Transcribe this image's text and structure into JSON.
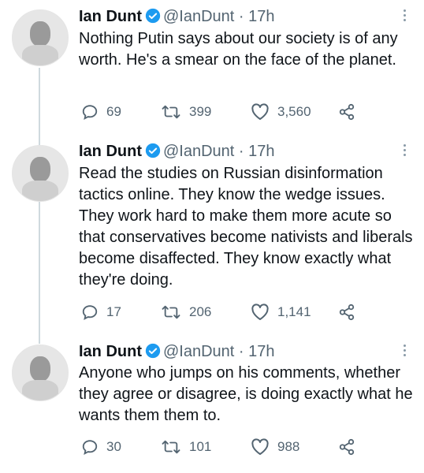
{
  "tweets": [
    {
      "name": "Ian Dunt",
      "handle": "@IanDunt",
      "time": "· 17h",
      "text": "Nothing Putin says about our society is of any worth. He's a smear on the face of the planet.",
      "replies": "69",
      "retweets": "399",
      "likes": "3,560"
    },
    {
      "name": "Ian Dunt",
      "handle": "@IanDunt",
      "time": "· 17h",
      "text": "Read the studies on Russian disinformation tactics online. They know the wedge issues. They work hard to make them more acute so that conservatives become nativists and liberals become disaffected. They know exactly what they're doing.",
      "replies": "17",
      "retweets": "206",
      "likes": "1,141"
    },
    {
      "name": "Ian Dunt",
      "handle": "@IanDunt",
      "time": "· 17h",
      "text": "Anyone who jumps on his comments, whether they agree or disagree, is doing exactly what he wants them them to.",
      "replies": "30",
      "retweets": "101",
      "likes": "988"
    }
  ],
  "colors": {
    "verified": "#1d9bf0",
    "muted": "#536471",
    "text": "#0f1419",
    "thread_line": "#cfd9de"
  }
}
